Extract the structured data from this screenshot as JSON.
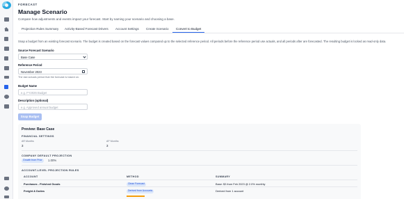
{
  "sidebar": {
    "items": [
      {
        "icon": "calculator-icon"
      },
      {
        "icon": "home-icon"
      },
      {
        "icon": "document-icon"
      },
      {
        "icon": "briefcase-icon"
      },
      {
        "icon": "file-icon"
      },
      {
        "icon": "wallet-icon"
      },
      {
        "icon": "transfer-icon"
      },
      {
        "icon": "report-icon",
        "active": true
      },
      {
        "icon": "gear-icon"
      },
      {
        "icon": "calculator-icon"
      }
    ],
    "bottom": [
      {
        "icon": "hierarchy-icon"
      },
      {
        "icon": "settings-icon"
      },
      {
        "icon": "logout-icon"
      }
    ]
  },
  "header": {
    "eyebrow": "FORECAST",
    "title": "Manage Scenario",
    "subtitle": "Compare how adjustments and events impact your forecast. Start by naming your scenario and choosing a base."
  },
  "tabs": [
    {
      "label": "Projection Rules Summary"
    },
    {
      "label": "Activity-Based Forecast Drivers"
    },
    {
      "label": "Account Settings"
    },
    {
      "label": "Create Scenario"
    },
    {
      "label": "Convert to Budget",
      "active": true
    }
  ],
  "helper_text": "Snap a budget from an existing forecast scenario. The budget is created based on the forecast values computed up to the selected reference period. All periods before the reference period use actuals, and all periods after are forecasted. The resulting budget is locked as read-only data.",
  "form": {
    "source_label": "Source Forecast Scenario",
    "source_value": "Base Case",
    "reference_label": "Reference Period",
    "reference_value": "November 2023",
    "reference_note": "The last actuals period that the forecast is based on.",
    "name_label": "Budget Name",
    "name_placeholder": "e.g. FY2026 Budget",
    "description_label": "Description (optional)",
    "description_placeholder": "e.g. Approved annual budget",
    "submit_label": "Snap Budget"
  },
  "preview": {
    "title": "Preview: Base Case",
    "financial_settings_title": "FINANCIAL SETTINGS",
    "ar_label": "AR Months",
    "ar_value": "3",
    "ap_label": "AP Months",
    "ap_value": "3",
    "company_title": "COMPANY DEFAULT PROJECTION",
    "company_method": "Growth from Prior",
    "company_rate": "1.00%",
    "account_rules_title": "ACCOUNT-LEVEL PROJECTION RULES",
    "columns": [
      "ACCOUNT",
      "METHOD",
      "SUMMARY"
    ],
    "rows": [
      {
        "account": "Purchases - Finished Goods",
        "method": "Clean Forecast",
        "summary": "Base: $3 from Feb 2023 @ 2.0% monthly"
      },
      {
        "account": "Freight & Duties",
        "method": "Derived from Accounts",
        "summary": "Derived from 1 account"
      }
    ]
  },
  "colors": {
    "accent": "#2563eb",
    "button_disabled": "#a9bff2",
    "pill_bg": "#dbe7fb",
    "highlight": "#f59e0b"
  }
}
